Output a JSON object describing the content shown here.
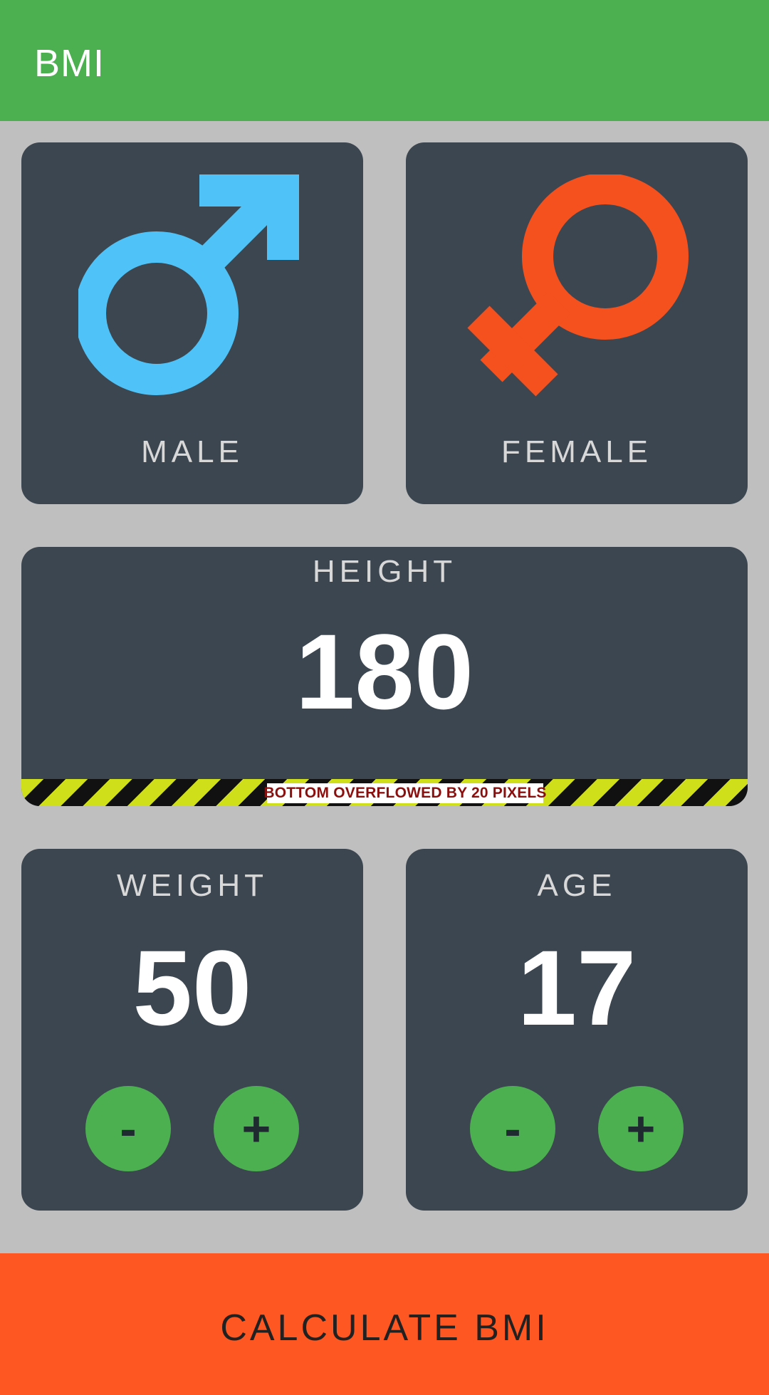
{
  "app": {
    "title": "BMI"
  },
  "gender": {
    "male": {
      "label": "MALE",
      "icon": "male-icon",
      "color": "#4fc3f7"
    },
    "female": {
      "label": "FEMALE",
      "icon": "female-icon",
      "color": "#f4511e"
    }
  },
  "height": {
    "label": "HEIGHT",
    "value": "180"
  },
  "overflow_warning": "BOTTOM OVERFLOWED BY 20 PIXELS",
  "weight": {
    "label": "WEIGHT",
    "value": "50",
    "minus": "-",
    "plus": "+"
  },
  "age": {
    "label": "AGE",
    "value": "17",
    "minus": "-",
    "plus": "+"
  },
  "calculate_button": {
    "label": "CALCULATE BMI"
  },
  "colors": {
    "primary": "#4caf50",
    "card": "#3c4650",
    "accent": "#ff5722"
  }
}
